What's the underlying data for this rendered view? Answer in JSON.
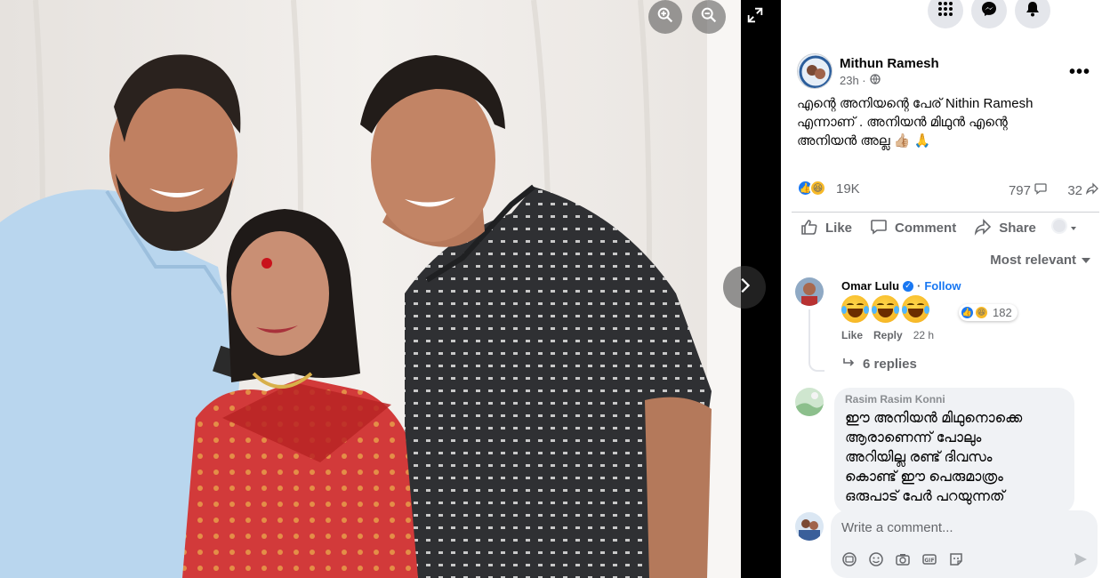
{
  "viewer": {
    "zoom_in_icon": "zoom-in-icon",
    "zoom_out_icon": "zoom-out-icon",
    "fullscreen_icon": "fullscreen-icon",
    "next_icon": "chevron-right-icon"
  },
  "topbar": {
    "icons": [
      "menu-grid-icon",
      "messenger-icon",
      "bell-icon"
    ]
  },
  "post": {
    "author": "Mithun Ramesh",
    "time": "23h ·",
    "text_line1": "എന്റെ അനിയന്റെ പേര് Nithin Ramesh",
    "text_line2": "എന്നാണ് . അനിയൻ മിഥുൻ എന്റെ",
    "text_line3": "അനിയൻ അല്ല 👍🏼 🙏",
    "reaction_count": "19K",
    "comment_count": "797",
    "share_count": "32"
  },
  "actions": {
    "like": "Like",
    "comment": "Comment",
    "share": "Share"
  },
  "sort_label": "Most relevant",
  "comments": [
    {
      "name": "Omar Lulu",
      "follow": "Follow",
      "reactions": "182",
      "like": "Like",
      "reply": "Reply",
      "time": "22 h",
      "replies": "6 replies"
    },
    {
      "name": "Rasim Rasim Konni",
      "line1": "ഈ അനിയൻ മിഥുനൊക്കെ",
      "line2": "ആരാണെന്ന് പോലും",
      "line3": "അറിയില്ല രണ്ട് ദിവസം",
      "line4": "കൊണ്ട് ഈ പെരുമാത്രം",
      "line5": "ഒരുപാട് പേർ പറയുന്നത്"
    }
  ],
  "write": {
    "placeholder": "Write a comment..."
  },
  "colors": {
    "accent": "#1877f2",
    "secondary_text": "#65676b",
    "bubble_bg": "#f0f2f5"
  }
}
